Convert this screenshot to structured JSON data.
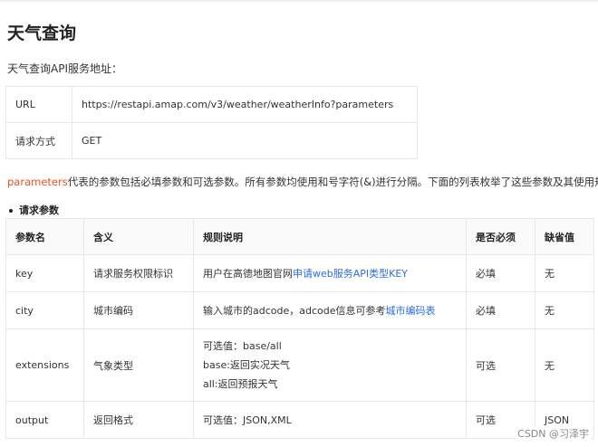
{
  "page": {
    "title": "天气查询",
    "intro": "天气查询API服务地址："
  },
  "service_table": {
    "rows": [
      {
        "key": "URL",
        "value": "https://restapi.amap.com/v3/weather/weatherInfo?parameters"
      },
      {
        "key": "请求方式",
        "value": "GET"
      }
    ]
  },
  "description": {
    "highlight": "parameters",
    "text": "代表的参数包括必填参数和可选参数。所有参数均使用和号字符(&)进行分隔。下面的列表枚举了这些参数及其使用规则。"
  },
  "section": {
    "label": "请求参数"
  },
  "params_table": {
    "headers": [
      "参数名",
      "含义",
      "规则说明",
      "是否必须",
      "缺省值"
    ],
    "rows": [
      {
        "name": "key",
        "meaning": "请求服务权限标识",
        "rule_prefix": "用户在高德地图官网",
        "rule_link": "申请web服务API类型KEY",
        "required": "必填",
        "default": "无"
      },
      {
        "name": "city",
        "meaning": "城市编码",
        "rule_prefix": "输入城市的adcode，adcode信息可参考",
        "rule_link": "城市编码表",
        "required": "必填",
        "default": "无"
      },
      {
        "name": "extensions",
        "meaning": "气象类型",
        "rule_lines": [
          "可选值：base/all",
          "base:返回实况天气",
          "all:返回预报天气"
        ],
        "required": "可选",
        "default": "无"
      },
      {
        "name": "output",
        "meaning": "返回格式",
        "rule": "可选值：JSON,XML",
        "required": "可选",
        "default": "JSON"
      }
    ]
  },
  "watermark": "CSDN @习泽宇"
}
